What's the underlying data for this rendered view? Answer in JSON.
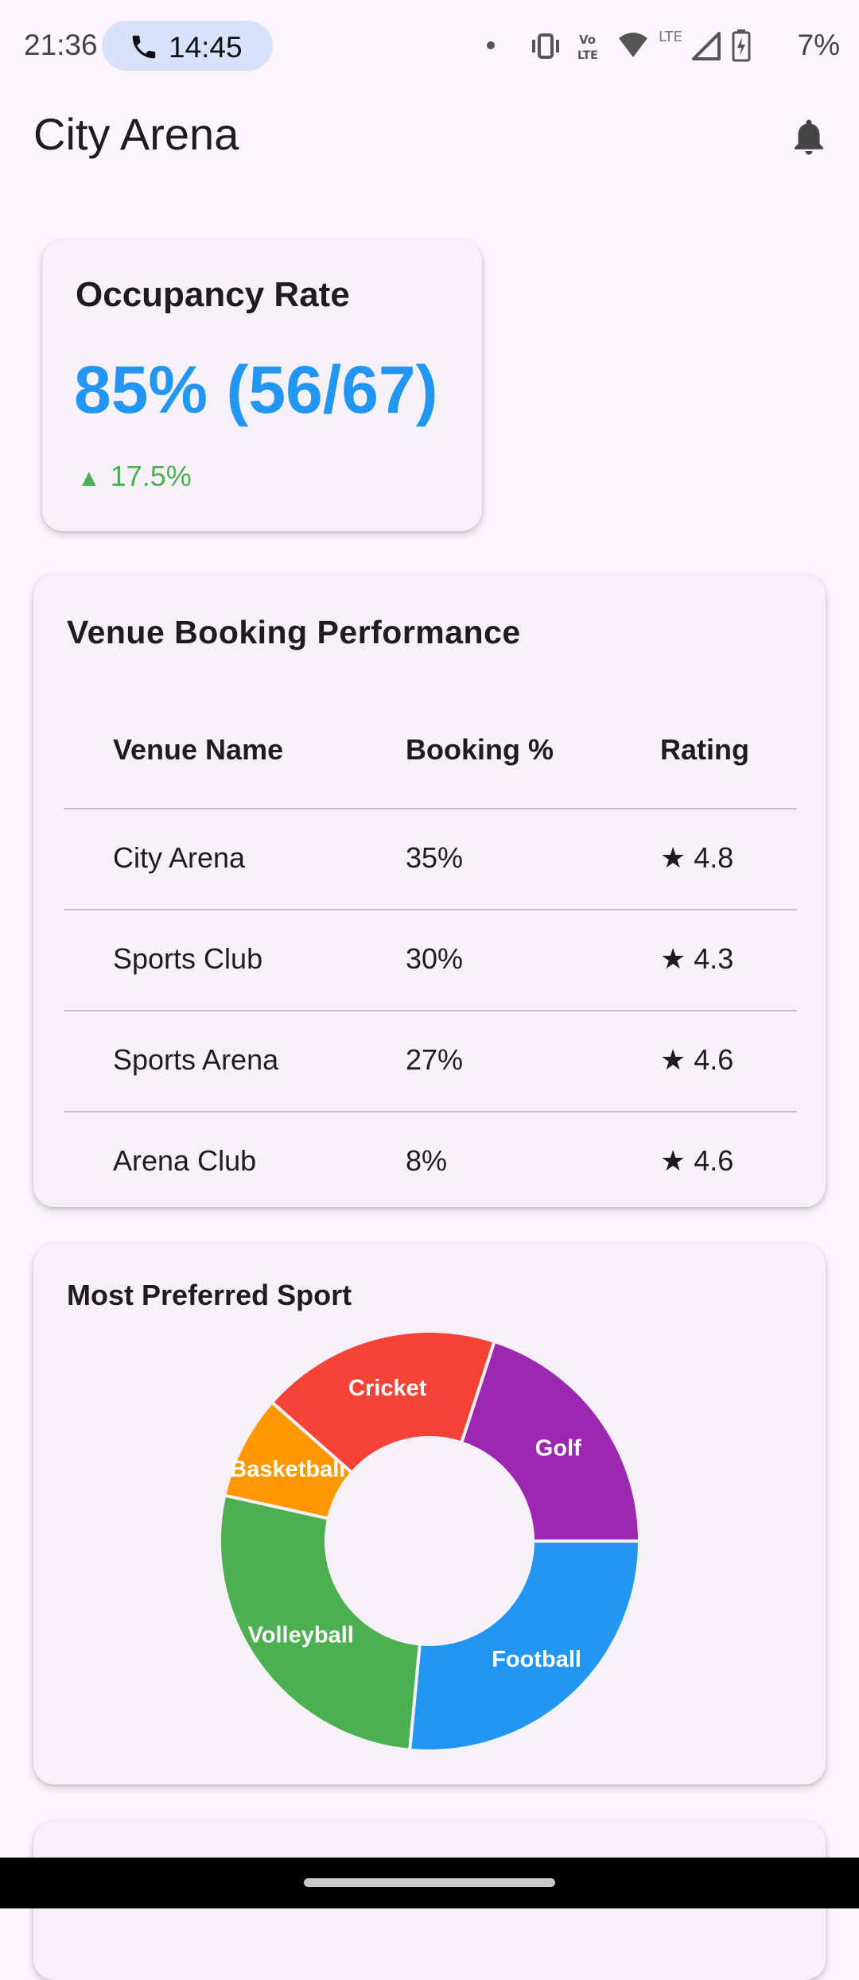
{
  "status_bar": {
    "time": "21:36",
    "call_duration": "14:45",
    "battery": "7%",
    "network": "LTE",
    "volte": "Vo LTE"
  },
  "app_bar": {
    "title": "City Arena",
    "icon": "bell-icon"
  },
  "occupancy": {
    "title": "Occupancy Rate",
    "value": "85% (56/67)",
    "trend": "17.5%",
    "trend_direction": "up",
    "value_color": "#2196f3",
    "trend_color": "#4caf50"
  },
  "venue_performance": {
    "title": "Venue Booking Performance",
    "columns": [
      "Venue Name",
      "Booking %",
      "Rating"
    ],
    "rows": [
      {
        "name": "City Arena",
        "booking": "35%",
        "rating": "★ 4.8"
      },
      {
        "name": "Sports Club",
        "booking": "30%",
        "rating": "★ 4.3"
      },
      {
        "name": "Sports Arena",
        "booking": "27%",
        "rating": "★ 4.6"
      },
      {
        "name": "Arena Club",
        "booking": "8%",
        "rating": "★ 4.6"
      }
    ]
  },
  "preferred_sport": {
    "title": "Most Preferred Sport"
  },
  "chart_data": {
    "type": "pie",
    "donut": true,
    "title": "Most Preferred Sport",
    "categories": [
      "Golf",
      "Football",
      "Volleyball",
      "Basketball",
      "Cricket"
    ],
    "values": [
      20,
      26.5,
      27,
      8,
      18.5
    ],
    "colors": [
      "#9c27b0",
      "#2196f3",
      "#4caf50",
      "#ff9800",
      "#f44336"
    ]
  }
}
